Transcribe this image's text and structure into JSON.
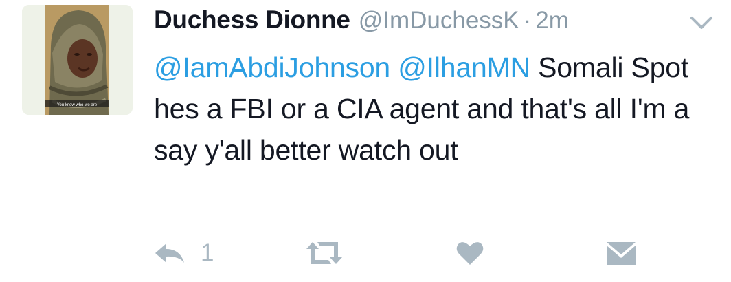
{
  "tweet": {
    "display_name": "Duchess Dionne",
    "handle": "@ImDuchessK",
    "separator": "·",
    "time": "2m",
    "body": {
      "mention_1": "@IamAbdiJohnson",
      "mention_2": "@IlhanMN",
      "text": "Somali Spot hes a FBI or a CIA agent and that's all I'm a say y'all better watch out"
    },
    "avatar_caption": "You know who we are"
  },
  "actions": {
    "reply_icon": "reply-icon",
    "reply_count": "1",
    "retweet_icon": "retweet-icon",
    "like_icon": "heart-icon",
    "dm_icon": "envelope-icon"
  },
  "colors": {
    "text": "#141823",
    "muted": "#8899a6",
    "link": "#2b9ee2",
    "action_icon": "#aab8c2"
  }
}
